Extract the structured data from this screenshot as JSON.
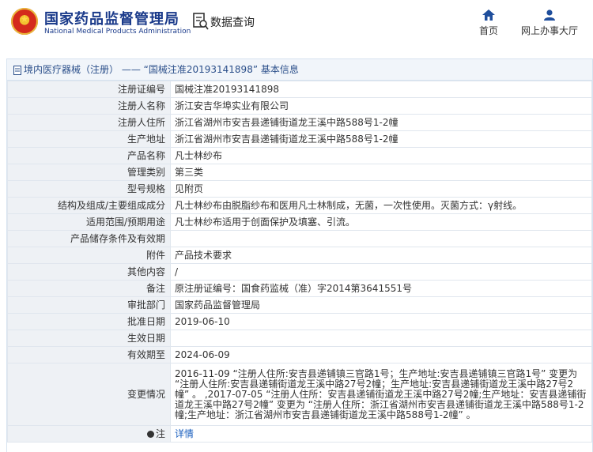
{
  "header": {
    "title_cn": "国家药品监督管理局",
    "title_en": "National Medical Products Administration",
    "search_label": "数据查询",
    "nav": [
      {
        "label": "首页",
        "icon": "home-icon"
      },
      {
        "label": "网上办事大厅",
        "icon": "user-icon"
      }
    ]
  },
  "panel": {
    "title": "境内医疗器械（注册） —— “国械注准20193141898” 基本信息"
  },
  "rows": [
    {
      "label": "注册证编号",
      "value": "国械注准20193141898"
    },
    {
      "label": "注册人名称",
      "value": "浙江安吉华埠实业有限公司"
    },
    {
      "label": "注册人住所",
      "value": "浙江省湖州市安吉县递铺街道龙王溪中路588号1-2幢"
    },
    {
      "label": "生产地址",
      "value": "浙江省湖州市安吉县递铺街道龙王溪中路588号1-2幢"
    },
    {
      "label": "产品名称",
      "value": "凡士林纱布"
    },
    {
      "label": "管理类别",
      "value": "第三类"
    },
    {
      "label": "型号规格",
      "value": "见附页"
    },
    {
      "label": "结构及组成/主要组成成分",
      "value": "凡士林纱布由脱脂纱布和医用凡士林制成，无菌，一次性使用。灭菌方式：γ射线。"
    },
    {
      "label": "适用范围/预期用途",
      "value": "凡士林纱布适用于创面保护及填塞、引流。"
    },
    {
      "label": "产品储存条件及有效期",
      "value": ""
    },
    {
      "label": "附件",
      "value": "产品技术要求"
    },
    {
      "label": "其他内容",
      "value": "/"
    },
    {
      "label": "备注",
      "value": "原注册证编号：国食药监械（准）字2014第3641551号"
    },
    {
      "label": "审批部门",
      "value": "国家药品监督管理局"
    },
    {
      "label": "批准日期",
      "value": "2019-06-10"
    },
    {
      "label": "生效日期",
      "value": ""
    },
    {
      "label": "有效期至",
      "value": "2024-06-09"
    },
    {
      "label": "变更情况",
      "value": "2016-11-09 “注册人住所:安吉县递铺镇三官路1号；生产地址:安吉县递铺镇三官路1号” 变更为 “注册人住所:安吉县递铺街道龙王溪中路27号2幢；生产地址:安吉县递铺街道龙王溪中路27号2幢” 。 ,2017-07-05 “注册人住所：安吉县递铺街道龙王溪中路27号2幢;生产地址：安吉县递铺街道龙王溪中路27号2幢” 变更为 “注册人住所：浙江省湖州市安吉县递铺街道龙王溪中路588号1-2幢;生产地址：浙江省湖州市安吉县递铺街道龙王溪中路588号1-2幢” 。"
    },
    {
      "label": "注",
      "value": "详情"
    }
  ]
}
